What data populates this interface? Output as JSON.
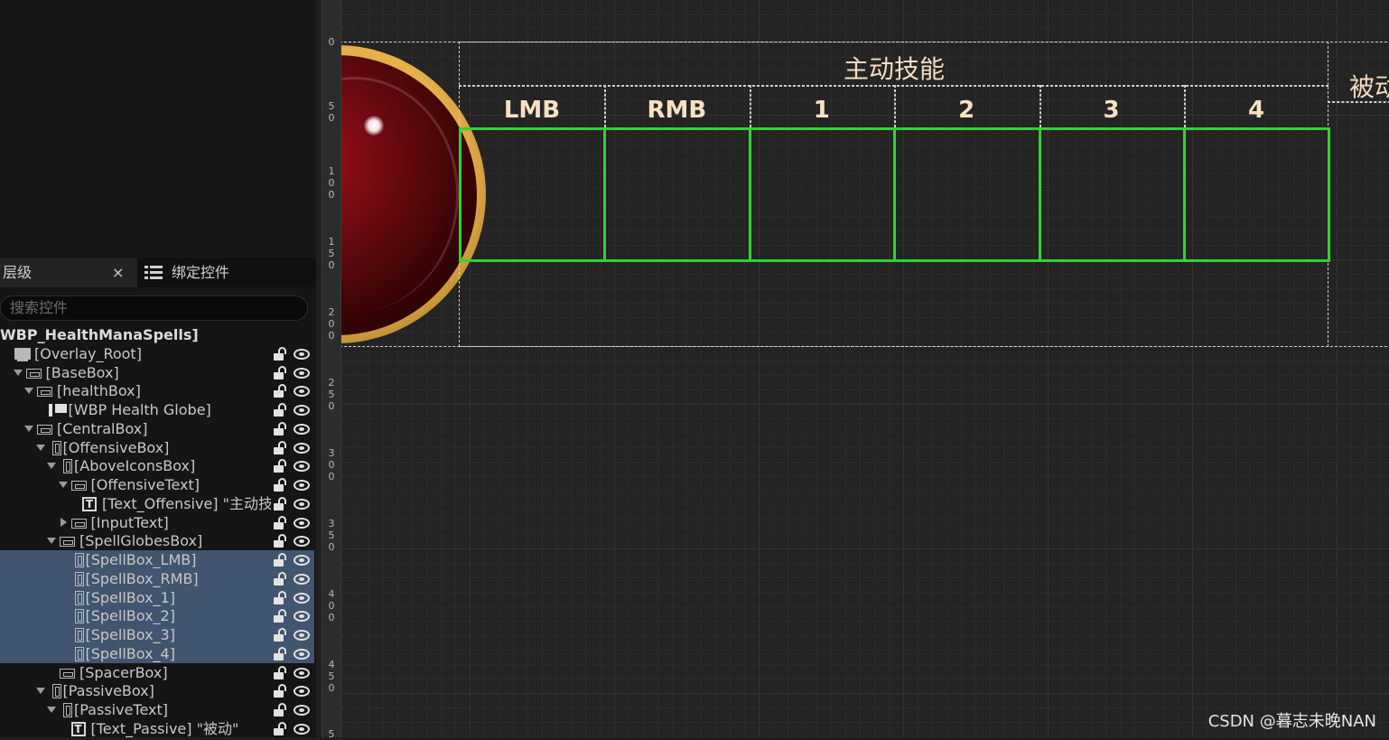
{
  "left_panel": {
    "tabs": {
      "hierarchy": "层级",
      "close": "×",
      "bind": "绑定控件"
    },
    "search_placeholder": "搜索控件",
    "tree": [
      {
        "label": "WBP_HealthManaSpells]",
        "indent": 0,
        "icon": "none",
        "arrow": "none",
        "root": true,
        "selected": false
      },
      {
        "label": "[Overlay_Root]",
        "indent": 0,
        "icon": "overlay",
        "arrow": "none",
        "selected": false
      },
      {
        "label": "[BaseBox]",
        "indent": 1,
        "icon": "hbox",
        "arrow": "expanded",
        "selected": false
      },
      {
        "label": "[healthBox]",
        "indent": 2,
        "icon": "hbox",
        "arrow": "expanded",
        "selected": false
      },
      {
        "label": "[WBP Health Globe]",
        "indent": 3,
        "icon": "userwidget",
        "arrow": "none",
        "selected": false
      },
      {
        "label": "[CentralBox]",
        "indent": 2,
        "icon": "hbox",
        "arrow": "expanded",
        "selected": false
      },
      {
        "label": "[OffensiveBox]",
        "indent": 3,
        "icon": "vbox",
        "arrow": "expanded",
        "selected": false
      },
      {
        "label": "[AboveIconsBox]",
        "indent": 4,
        "icon": "vbox",
        "arrow": "expanded",
        "selected": false
      },
      {
        "label": "[OffensiveText]",
        "indent": 5,
        "icon": "hbox",
        "arrow": "expanded",
        "selected": false
      },
      {
        "label": "[Text_Offensive] \"主动技能\"",
        "indent": 6,
        "icon": "text",
        "arrow": "none",
        "selected": false
      },
      {
        "label": "[InputText]",
        "indent": 5,
        "icon": "hbox",
        "arrow": "collapsed",
        "selected": false
      },
      {
        "label": "[SpellGlobesBox]",
        "indent": 4,
        "icon": "hbox",
        "arrow": "expanded",
        "selected": false
      },
      {
        "label": "[SpellBox_LMB]",
        "indent": 5,
        "icon": "vbox",
        "arrow": "none",
        "selected": true
      },
      {
        "label": "[SpellBox_RMB]",
        "indent": 5,
        "icon": "vbox",
        "arrow": "none",
        "selected": true
      },
      {
        "label": "[SpellBox_1]",
        "indent": 5,
        "icon": "vbox",
        "arrow": "none",
        "selected": true
      },
      {
        "label": "[SpellBox_2]",
        "indent": 5,
        "icon": "vbox",
        "arrow": "none",
        "selected": true
      },
      {
        "label": "[SpellBox_3]",
        "indent": 5,
        "icon": "vbox",
        "arrow": "none",
        "selected": true
      },
      {
        "label": "[SpellBox_4]",
        "indent": 5,
        "icon": "vbox",
        "arrow": "none",
        "selected": true
      },
      {
        "label": "[SpacerBox]",
        "indent": 4,
        "icon": "hbox",
        "arrow": "none",
        "selected": false
      },
      {
        "label": "[PassiveBox]",
        "indent": 3,
        "icon": "vbox",
        "arrow": "expanded",
        "selected": false
      },
      {
        "label": "[PassiveText]",
        "indent": 4,
        "icon": "vbox",
        "arrow": "expanded",
        "selected": false
      },
      {
        "label": "[Text_Passive] \"被动\"",
        "indent": 5,
        "icon": "text",
        "arrow": "none",
        "selected": false
      }
    ]
  },
  "ruler": {
    "labels": [
      {
        "text": "0"
      },
      {
        "text": "5\n0"
      },
      {
        "text": "1\n0\n0"
      },
      {
        "text": "1\n5\n0"
      },
      {
        "text": "2\n0\n0"
      },
      {
        "text": "2\n5\n0"
      },
      {
        "text": "3\n0\n0"
      },
      {
        "text": "3\n5\n0"
      },
      {
        "text": "4\n0\n0"
      },
      {
        "text": "4\n5\n0"
      },
      {
        "text": "5"
      }
    ]
  },
  "canvas": {
    "offensive_title": "主动技能",
    "passive_title": "被动",
    "input_labels": [
      "LMB",
      "RMB",
      "1",
      "2",
      "3",
      "4"
    ],
    "slot_border_color": "#2fd42f",
    "globe_ring_color": "#e6b04a",
    "globe_fill_color": "#6a0a10"
  },
  "watermark": "CSDN @暮志未晚NAN"
}
